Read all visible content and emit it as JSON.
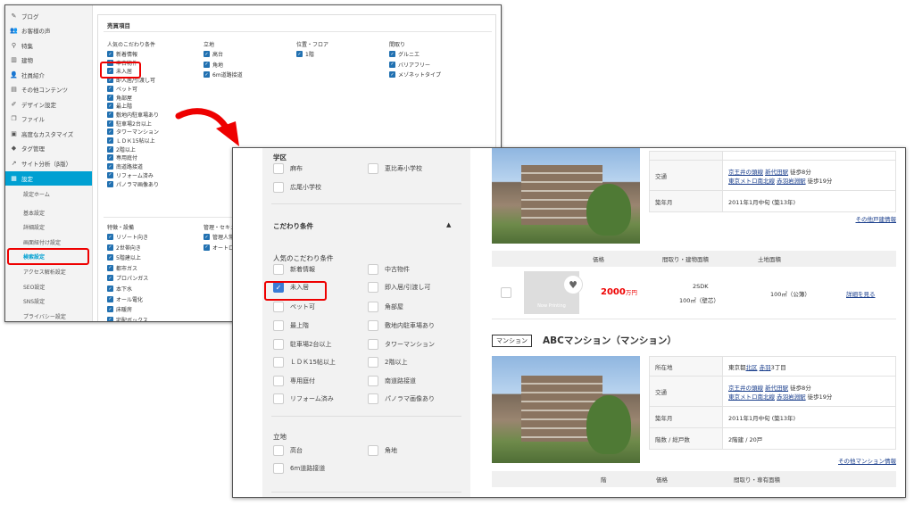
{
  "admin": {
    "nav": [
      {
        "label": "ブログ",
        "icon": "pencil-icon"
      },
      {
        "label": "お客様の声",
        "icon": "people-icon"
      },
      {
        "label": "特集",
        "icon": "pin-icon"
      },
      {
        "label": "建物",
        "icon": "building-icon"
      },
      {
        "label": "社員紹介",
        "icon": "person-icon"
      },
      {
        "label": "その他コンテンツ",
        "icon": "page-icon"
      },
      {
        "label": "デザイン設定",
        "icon": "brush-icon"
      },
      {
        "label": "ファイル",
        "icon": "file-icon"
      },
      {
        "label": "高度なカスタマイズ",
        "icon": "code-icon"
      },
      {
        "label": "タグ管理",
        "icon": "tag-icon"
      },
      {
        "label": "サイト分析（β版）",
        "icon": "chart-icon"
      },
      {
        "label": "設定",
        "icon": "settings-icon"
      }
    ],
    "sub": [
      "設定ホーム",
      "基本設定",
      "詳細設定",
      "画面紐付け設定",
      "検索設定",
      "アクセス解析設定",
      "SEO設定",
      "SNS設定",
      "プライバシー設定"
    ],
    "panel_title": "売買項目",
    "sections": {
      "popular": {
        "title": "人気のこだわり条件",
        "items": [
          "新着情報",
          "中古物件",
          "未入居",
          "即入居/引渡し可",
          "ペット可",
          "角部屋",
          "最上階",
          "敷地内駐車場あり",
          "駐車場2台以上",
          "タワーマンション",
          "ＬＤＫ15帖以上",
          "2階以上",
          "専用庭付",
          "南道路接道",
          "リフォーム済み",
          "パノラマ画像あり"
        ]
      },
      "location": {
        "title": "立地",
        "items": [
          "高台",
          "角地",
          "6m道路接道"
        ]
      },
      "position": {
        "title": "位置・フロア",
        "items": [
          "1階"
        ]
      },
      "layout": {
        "title": "間取り",
        "items": [
          "グルニエ",
          "バリアフリー",
          "メゾネットタイプ"
        ]
      },
      "features": {
        "title": "特徴・設備",
        "items": [
          "リゾート向き",
          "2世帯向き",
          "5階建以上",
          "都市ガス",
          "プロパンガス",
          "本下水",
          "オール電化",
          "床暖房",
          "宅配ボックス"
        ]
      },
      "management": {
        "title": "管理・セキュ",
        "items": [
          "管理人常駐",
          "オートロッ"
        ]
      }
    }
  },
  "front": {
    "school": {
      "title": "学区",
      "items": [
        "麻布",
        "恵比寿小学校",
        "広尾小学校"
      ]
    },
    "kodawari": {
      "title": "こだわり条件",
      "toggle": "▲"
    },
    "popular": {
      "title": "人気のこだわり条件",
      "items": [
        "新着情報",
        "中古物件",
        "未入居",
        "即入居/引渡し可",
        "ペット可",
        "角部屋",
        "最上階",
        "敷地内駐車場あり",
        "駐車場2台以上",
        "タワーマンション",
        "ＬＤＫ15帖以上",
        "2階以上",
        "専用庭付",
        "南道路接道",
        "リフォーム済み",
        "パノラマ画像あり"
      ]
    },
    "ritchi": {
      "title": "立地",
      "items": [
        "高台",
        "角地",
        "6m道路接道"
      ]
    },
    "listing1": {
      "rows": [
        {
          "key": "交通",
          "lines": [
            {
              "links": [
                "京王井の頭線",
                "新代田駅"
              ],
              "tail": "徒歩8分"
            },
            {
              "links": [
                "東京メトロ南北線",
                "赤羽岩淵駅"
              ],
              "tail": "徒歩19分"
            }
          ]
        },
        {
          "key": "築年月",
          "value": "2011年1月中旬 (築13年)"
        }
      ],
      "more": "その他戸建情報",
      "headers": [
        "価格",
        "間取り・建物面積",
        "土地面積"
      ],
      "unit": {
        "price": "2000",
        "price_unit": "万円",
        "plan": "2SDK",
        "area": "100㎡（壁芯）",
        "land": "100㎡（公簿）",
        "detail": "詳細を見る",
        "noimage": "Now Printing"
      }
    },
    "listing2": {
      "badge": "マンション",
      "name": "ABCマンション（マンション）",
      "rows": [
        {
          "key": "所在地",
          "pre": "東京都",
          "links": [
            "北区",
            "赤羽"
          ],
          "post": "3丁目"
        },
        {
          "key": "交通",
          "lines": [
            {
              "links": [
                "京王井の頭線",
                "新代田駅"
              ],
              "tail": "徒歩8分"
            },
            {
              "links": [
                "東京メトロ南北線",
                "赤羽岩淵駅"
              ],
              "tail": "徒歩19分"
            }
          ]
        },
        {
          "key": "築年月",
          "value": "2011年1月中旬 (築13年)"
        },
        {
          "key": "階数 / 総戸数",
          "value": "2階建 / 20戸"
        }
      ],
      "more": "その他マンション情報",
      "headers": [
        "階",
        "価格",
        "間取り・専有面積"
      ]
    }
  }
}
